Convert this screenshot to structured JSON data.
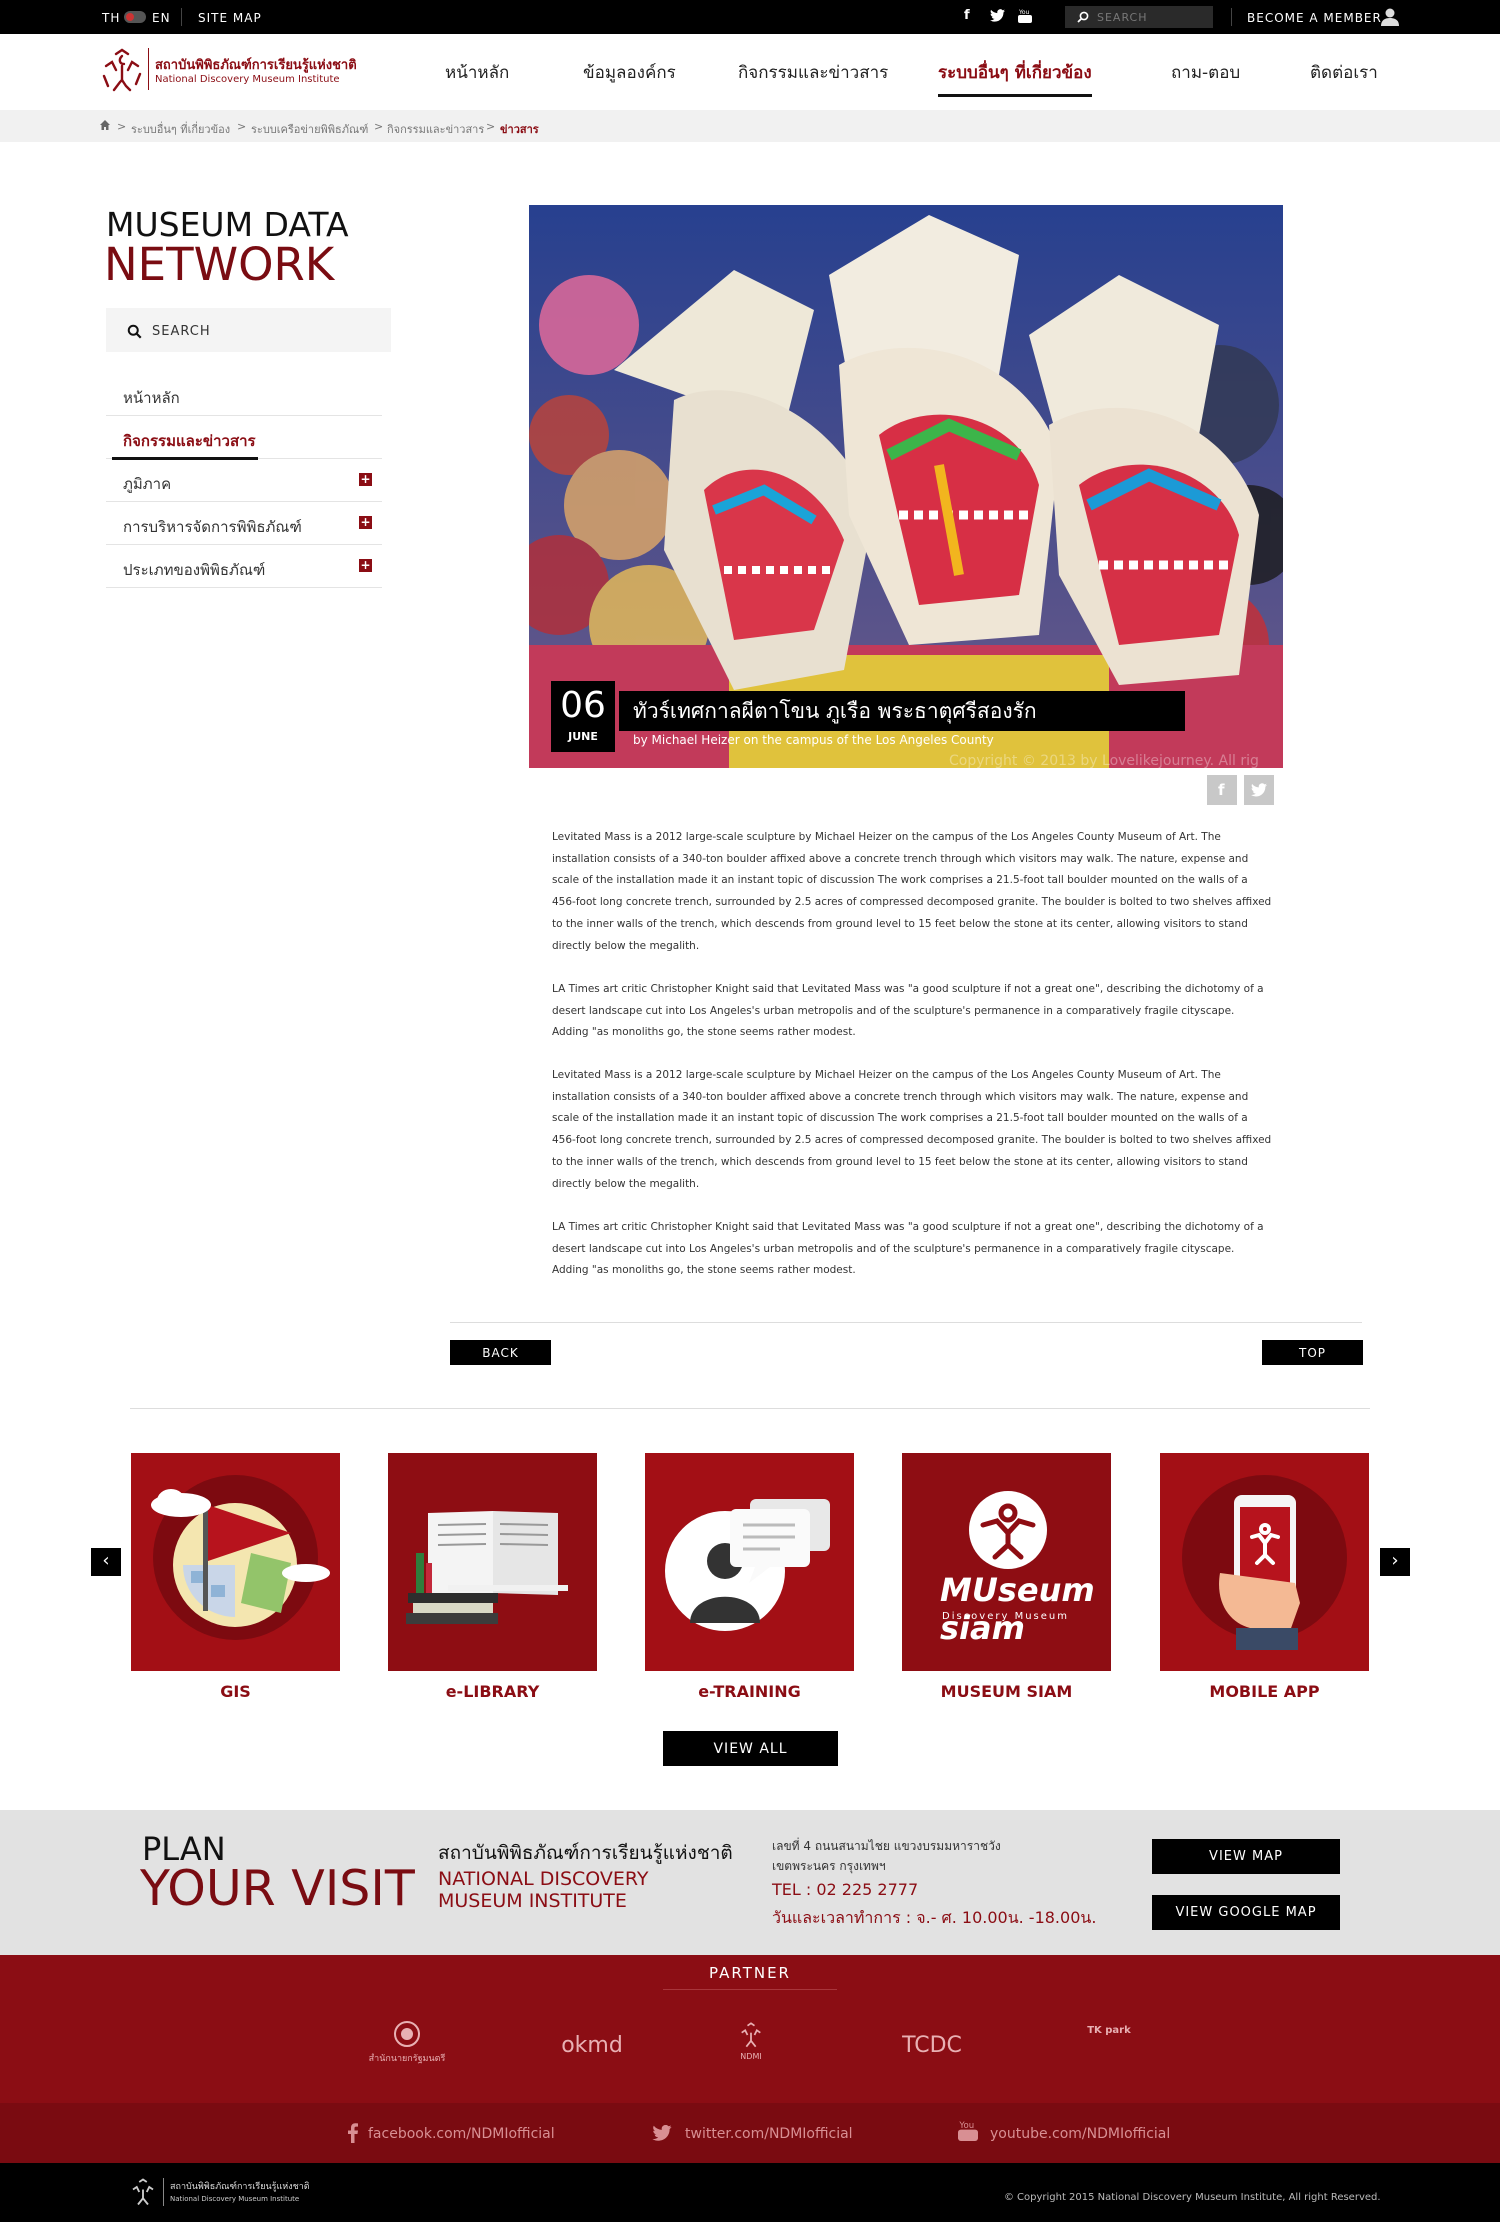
{
  "topbar": {
    "lang_th": "TH",
    "lang_en": "EN",
    "site_map": "SITE MAP",
    "search_placeholder": "SEARCH",
    "become_member": "BECOME A MEMBER",
    "social_icons": [
      "facebook-icon",
      "twitter-icon",
      "youtube-icon"
    ]
  },
  "header": {
    "logo_th": "สถาบันพิพิธภัณฑ์การเรียนรู้แห่งชาติ",
    "logo_en": "National Discovery Museum Institute",
    "nav": [
      {
        "label": "หน้าหลัก",
        "active": false
      },
      {
        "label": "ข้อมูลองค์กร",
        "active": false
      },
      {
        "label": "กิจกรรมและข่าวสาร",
        "active": false
      },
      {
        "label": "ระบบอื่นๆ ที่เกี่ยวข้อง",
        "active": true
      },
      {
        "label": "ถาม-ตอบ",
        "active": false
      },
      {
        "label": "ติดต่อเรา",
        "active": false
      }
    ]
  },
  "breadcrumb": [
    "ระบบอื่นๆ ที่เกี่ยวข้อง",
    "ระบบเครือข่ายพิพิธภัณฑ์",
    "กิจกรรมและข่าวสาร",
    "ข่าวสาร"
  ],
  "sidebar": {
    "title_line1": "MUSEUM DATA",
    "title_line2": "NETWORK",
    "search_placeholder": "SEARCH",
    "items": [
      {
        "label": "หน้าหลัก",
        "expandable": false,
        "active": false
      },
      {
        "label": "กิจกรรมและข่าวสาร",
        "expandable": false,
        "active": true
      },
      {
        "label": "ภูมิภาค",
        "expandable": true,
        "active": false
      },
      {
        "label": "การบริหารจัดการพิพิธภัณฑ์",
        "expandable": true,
        "active": false
      },
      {
        "label": "ประเภทของพิพิธภัณฑ์",
        "expandable": true,
        "active": false
      }
    ]
  },
  "article": {
    "day": "06",
    "month": "JUNE",
    "title": "ทัวร์เทศกาลผีตาโขน ภูเรือ พระธาตุศรีสองรัก",
    "subtitle": "by Michael Heizer on the campus of the Los Angeles County",
    "image_credit": "Copyright © 2013 by Lovelikejourney. All rig",
    "paragraphs": [
      "Levitated Mass is a 2012 large-scale sculpture by Michael Heizer on the campus of the Los Angeles County Museum of Art. The installation consists of a 340-ton boulder affixed above a concrete trench through which visitors may walk. The nature, expense and scale of the installation made it an instant topic of discussion The work comprises a 21.5-foot tall boulder mounted on the walls of a 456-foot long concrete trench, surrounded by 2.5 acres of compressed decomposed granite. The boulder is bolted to two shelves affixed to the inner walls of the trench, which descends from ground level to 15 feet below the stone at its center, allowing visitors to stand directly below the megalith.",
      "LA Times art critic Christopher Knight said that Levitated Mass was \"a good sculpture if not a great one\", describing the dichotomy of a desert landscape cut into Los Angeles's urban metropolis and of the sculpture's permanence in a comparatively fragile cityscape. Adding \"as monoliths go, the stone seems rather modest.",
      "Levitated Mass is a 2012 large-scale sculpture by Michael Heizer on the campus of the Los Angeles County Museum of Art. The installation consists of a 340-ton boulder affixed above a concrete trench through which visitors may walk. The nature, expense and scale of the installation made it an instant topic of discussion The work comprises a 21.5-foot tall boulder mounted on the walls of a 456-foot long concrete trench, surrounded by 2.5 acres of compressed decomposed granite. The boulder is bolted to two shelves affixed to the inner walls of the trench, which descends from ground level to 15 feet below the stone at its center, allowing visitors to stand directly below the megalith.",
      "LA Times art critic Christopher Knight said that Levitated Mass was \"a good sculpture if not a great one\", describing the dichotomy of a desert landscape cut into Los Angeles's urban metropolis and of the sculpture's permanence in a comparatively fragile cityscape. Adding \"as monoliths go, the stone seems rather modest."
    ],
    "back_label": "BACK",
    "top_label": "TOP"
  },
  "services": {
    "tiles": [
      {
        "label": "GIS",
        "icon": "map-flag-icon"
      },
      {
        "label": "e-LIBRARY",
        "icon": "book-icon"
      },
      {
        "label": "e-TRAINING",
        "icon": "chat-person-icon"
      },
      {
        "label": "MUSEUM SIAM",
        "icon": "museum-siam-logo"
      },
      {
        "label": "MOBILE APP",
        "icon": "mobile-phone-icon"
      }
    ],
    "museum_siam_logo_text": "MUseum siam",
    "museum_siam_logo_sub": "Discovery Museum",
    "view_all_label": "VIEW ALL",
    "prev_icon": "chevron-left-icon",
    "next_icon": "chevron-right-icon"
  },
  "plan": {
    "line1": "PLAN",
    "line2": "YOUR VISIT",
    "inst_th": "สถาบันพิพิธภัณฑ์การเรียนรู้แห่งชาติ",
    "inst_en": "NATIONAL DISCOVERY MUSEUM INSTITUTE",
    "address_line1": "เลขที่ 4 ถนนสนามไชย แขวงบรมมหาราชวัง",
    "address_line2": "เขตพระนคร กรุงเทพฯ",
    "tel": "TEL : 02 225 2777",
    "hours": "วันและเวลาทำการ : จ.- ศ. 10.00น. -18.00น.",
    "view_map_label": "VIEW MAP",
    "view_google_map_label": "VIEW GOOGLE MAP"
  },
  "partner": {
    "title": "PARTNER",
    "logos": [
      "สำนักนายกรัฐมนตรี",
      "okmd",
      "NDMI",
      "TCDC",
      "TK park"
    ]
  },
  "social_links": {
    "facebook": "facebook.com/NDMIofficial",
    "twitter": "twitter.com/NDMIofficial",
    "youtube": "youtube.com/NDMIofficial"
  },
  "footer": {
    "logo_th": "สถาบันพิพิธภัณฑ์การเรียนรู้แห่งชาติ",
    "logo_en": "National Discovery Museum Institute",
    "copyright": "Copyright 2015 National Discovery Museum Institute, All right Reserved."
  },
  "colors": {
    "brand_red": "#8b0d14",
    "dark_red": "#7a0b11",
    "black": "#000000"
  }
}
